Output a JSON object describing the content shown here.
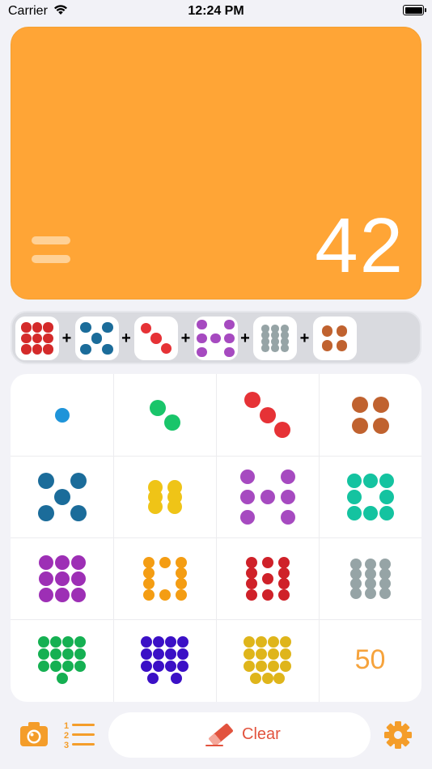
{
  "status_bar": {
    "carrier": "Carrier",
    "time": "12:24 PM"
  },
  "display": {
    "result": "42",
    "equals_icon": "equals-icon"
  },
  "tray": {
    "items": [
      {
        "count": 9,
        "color": "#d42a2a"
      },
      {
        "count": 5,
        "color": "#1b6c9a"
      },
      {
        "count": 3,
        "color": "#e63236"
      },
      {
        "count": 7,
        "color": "#a64ac0"
      },
      {
        "count": 12,
        "color": "#96a4a6"
      },
      {
        "count": 4,
        "color": "#c0622f"
      }
    ],
    "operator": "+"
  },
  "keypad": {
    "keys": [
      {
        "value": 1,
        "color": "#1f94d9"
      },
      {
        "value": 2,
        "color": "#19c56a"
      },
      {
        "value": 3,
        "color": "#e63236"
      },
      {
        "value": 4,
        "color": "#c0622f"
      },
      {
        "value": 5,
        "color": "#1b6c9a"
      },
      {
        "value": 6,
        "color": "#efc417"
      },
      {
        "value": 7,
        "color": "#a64ac0"
      },
      {
        "value": 8,
        "color": "#14c3a0"
      },
      {
        "value": 9,
        "color": "#9d2fb5"
      },
      {
        "value": 10,
        "color": "#f49d13"
      },
      {
        "value": 11,
        "color": "#cf2129"
      },
      {
        "value": 12,
        "color": "#96a4a6"
      },
      {
        "value": 13,
        "color": "#15b052"
      },
      {
        "value": 14,
        "color": "#3b10c6"
      },
      {
        "value": 15,
        "color": "#dfb51b"
      }
    ],
    "last_key_label": "50"
  },
  "toolbar": {
    "camera_icon": "camera-icon",
    "list_icon": "numbered-list-icon",
    "clear_label": "Clear",
    "eraser_icon": "eraser-icon",
    "settings_icon": "gear-icon"
  },
  "colors": {
    "accent": "#ffa536",
    "clear_text": "#e2533e"
  }
}
